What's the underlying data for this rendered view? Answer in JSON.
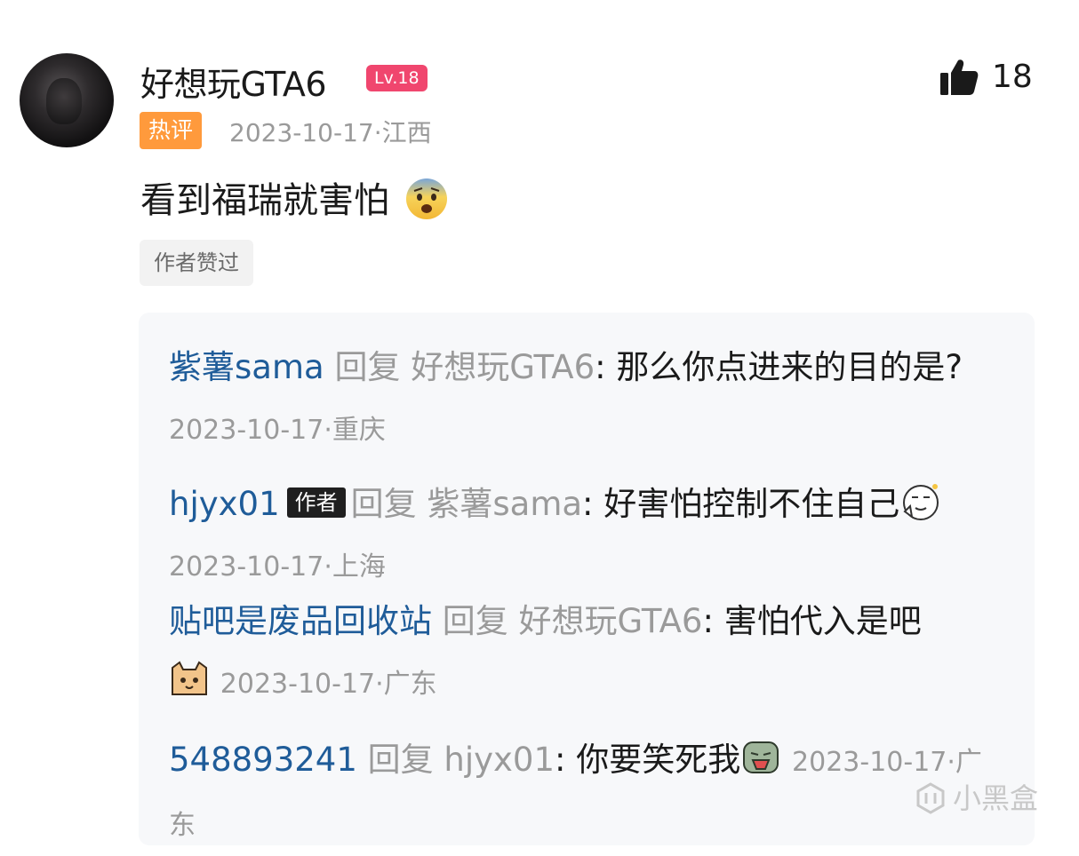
{
  "comment": {
    "username": "好想玩GTA6",
    "level": "Lv.18",
    "likes": "18",
    "hot_tag": "热评",
    "date_location": "2023-10-17·江西",
    "text": "看到福瑞就害怕",
    "emoji": "fearful-face-emoji",
    "author_liked": "作者赞过"
  },
  "replies": [
    {
      "name": "紫薯sama",
      "verb": "回复",
      "target": "好想玩GTA6",
      "text": ": 那么你点进来的目的是?",
      "date_location": "2023-10-17·重庆"
    },
    {
      "name": "hjyx01",
      "author_tag": "作者",
      "verb": "回复",
      "target": "紫薯sama",
      "text": ": 好害怕控制不住自己",
      "sticker": "thinking-sticker",
      "date_location": "2023-10-17·上海"
    },
    {
      "name": "贴吧是废品回收站",
      "verb": "回复",
      "target": "好想玩GTA6",
      "text": ": 害怕代入是吧",
      "sticker": "cat-face-sticker",
      "date_location": "2023-10-17·广东"
    },
    {
      "name": "548893241",
      "verb": "回复",
      "target": "hjyx01",
      "text": ": 你要笑死我",
      "sticker": "laughing-sticker",
      "date_location": "2023-10-17·广东"
    }
  ],
  "watermark": "小黑盒",
  "colors": {
    "level_badge": "#f0466e",
    "hot_tag": "#ff9a3c",
    "reply_name": "#1f5c99",
    "muted": "#9a9a9a"
  }
}
